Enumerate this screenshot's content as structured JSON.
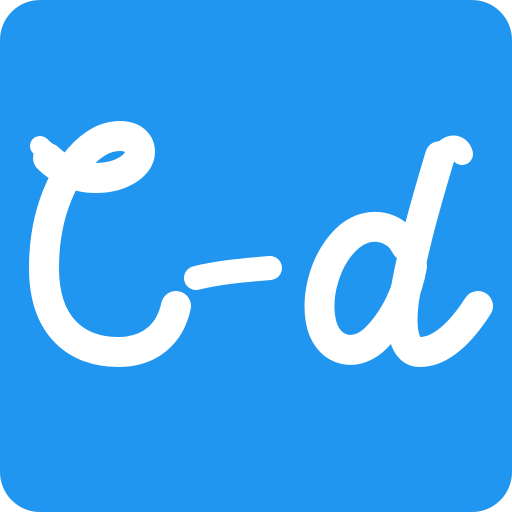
{
  "app_icon": {
    "logo_text": "C-d",
    "colors": {
      "background": "#2196F0",
      "glyph": "#FFFFFF"
    },
    "icon_name": "c-d-app-logo-icon"
  }
}
